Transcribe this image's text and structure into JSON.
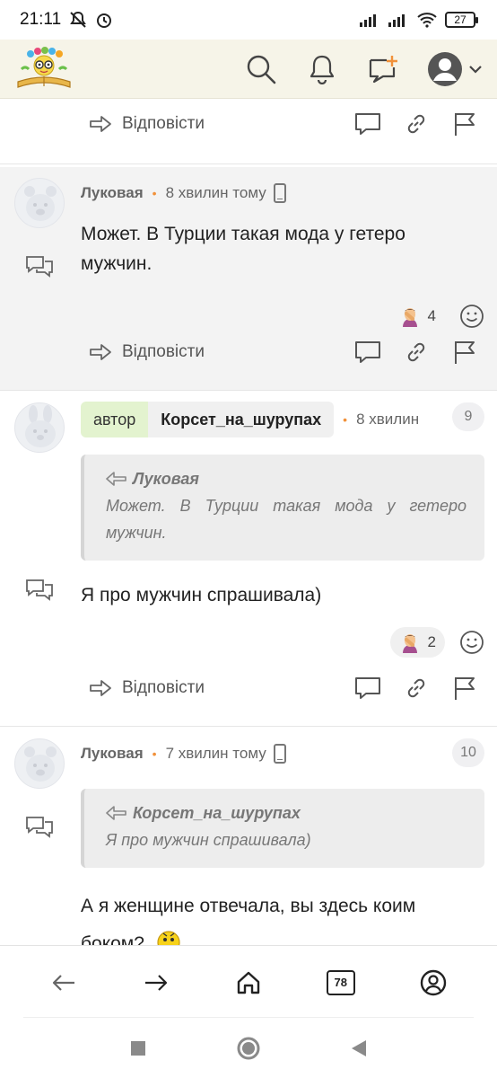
{
  "status_bar": {
    "time": "21:11",
    "battery": "27"
  },
  "header": {
    "logo_icon": "book-with-flowers-logo",
    "search_icon": "search-icon",
    "notifications_icon": "bell-icon",
    "new_post_icon": "new-chat-plus-icon",
    "profile_icon": "user-avatar-icon"
  },
  "comments": [
    {
      "reply_label": "Відповісти"
    },
    {
      "author": "Луковая",
      "time": "8 хвилин тому",
      "text": "Может. В Турции такая мода у гетеро мужчин.",
      "reaction_count": "4",
      "reply_label": "Відповісти"
    },
    {
      "author_badge": "автор",
      "author": "Корсет_на_шурупах",
      "time": "8 хвилин",
      "number": "9",
      "quote_author": "Луковая",
      "quote_text": "Может. В Турции такая мода у гетеро мужчин.",
      "text": "Я про мужчин спрашивала)",
      "reaction_count": "2",
      "reply_label": "Відповісти"
    },
    {
      "author": "Луковая",
      "time": "7 хвилин тому",
      "number": "10",
      "quote_author": "Корсет_на_шурупах",
      "quote_text": "Я про мужчин спрашивала)",
      "text": "А я женщине отвечала, вы здесь коим боком?"
    }
  ],
  "bottom_nav": {
    "tabs_count": "78"
  },
  "colors": {
    "header_bg": "#f6f4e8",
    "highlight_bg": "#f3f3f3",
    "author_badge_bg": "#e3f3cf",
    "dot_accent": "#f1913a"
  }
}
